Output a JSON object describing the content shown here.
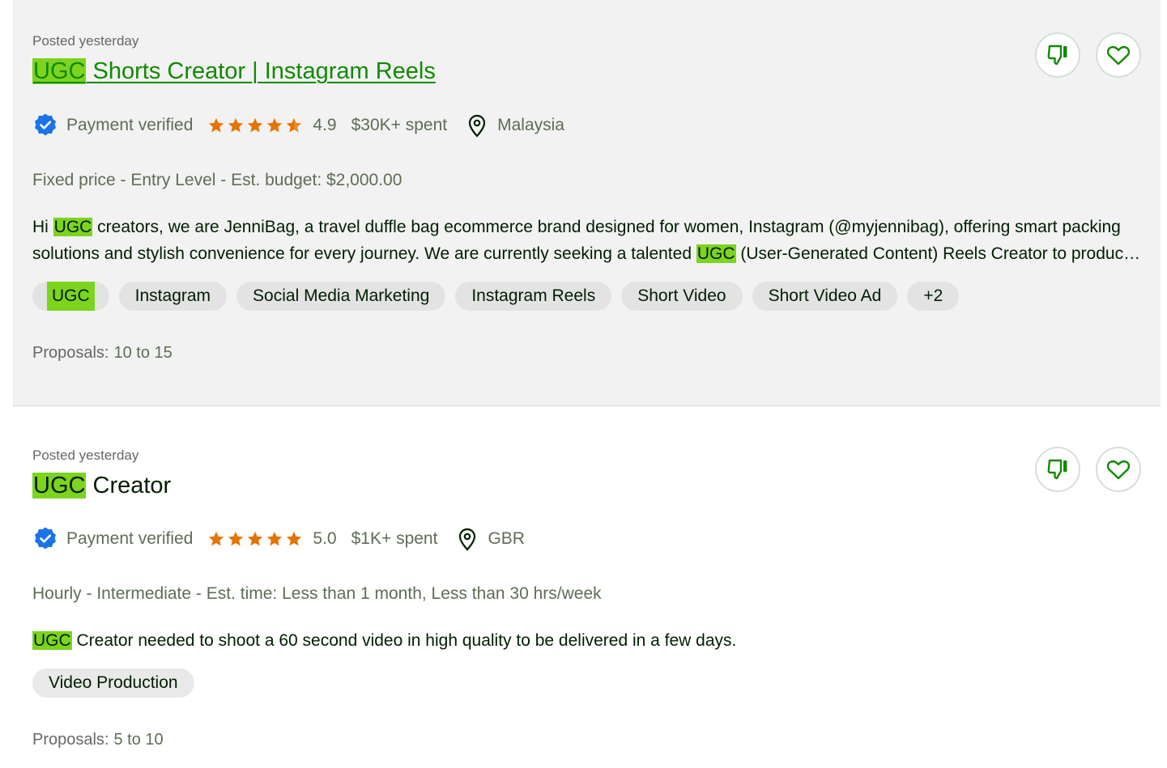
{
  "jobs": [
    {
      "posted": "Posted yesterday",
      "title_hl": "UGC",
      "title_rest": " Shorts Creator | Instagram Reels",
      "payment": "Payment verified",
      "rating": "4.9",
      "rating_value": 4.9,
      "spent": "$30K+ spent",
      "location": "Malaysia",
      "meta": "Fixed price - Entry Level - Est. budget: $2,000.00",
      "desc": {
        "p1": "Hi ",
        "hl1": "UGC",
        "p2": " creators, we are JenniBag, a travel duffle bag ecommerce brand designed for women, Instagram (@myjennibag), offering smart packing solutions and stylish convenience for every journey. We are currently seeking a talented ",
        "hl2": "UGC",
        "p3": " (User-Generated Content) Reels Creator to produce high-quality short videos for our brand."
      },
      "tags": [
        "UGC",
        "Instagram",
        "Social Media Marketing",
        "Instagram Reels",
        "Short Video",
        "Short Video Ad",
        "+2"
      ],
      "proposals_label": "Proposals:",
      "proposals_value": "10 to 15"
    },
    {
      "posted": "Posted yesterday",
      "title_hl": "UGC",
      "title_rest": " Creator",
      "payment": "Payment verified",
      "rating": "5.0",
      "rating_value": 5.0,
      "spent": "$1K+ spent",
      "location": "GBR",
      "meta": "Hourly - Intermediate - Est. time: Less than 1 month, Less than 30 hrs/week",
      "desc": {
        "hl1": "UGC",
        "p2": " Creator needed to shoot a 60 second video in high quality to be delivered in a few days."
      },
      "tags": [
        "Video Production"
      ],
      "proposals_label": "Proposals:",
      "proposals_value": "5 to 10"
    }
  ],
  "icons": {
    "dislike": "thumbs-down-icon",
    "save": "heart-icon",
    "verified": "verified-badge-icon",
    "star": "star-icon",
    "location": "location-pin-icon"
  },
  "colors": {
    "brand_green": "#108a00",
    "highlight": "#7cd41e",
    "star": "#e67300",
    "verified_blue": "#1a73e8"
  }
}
